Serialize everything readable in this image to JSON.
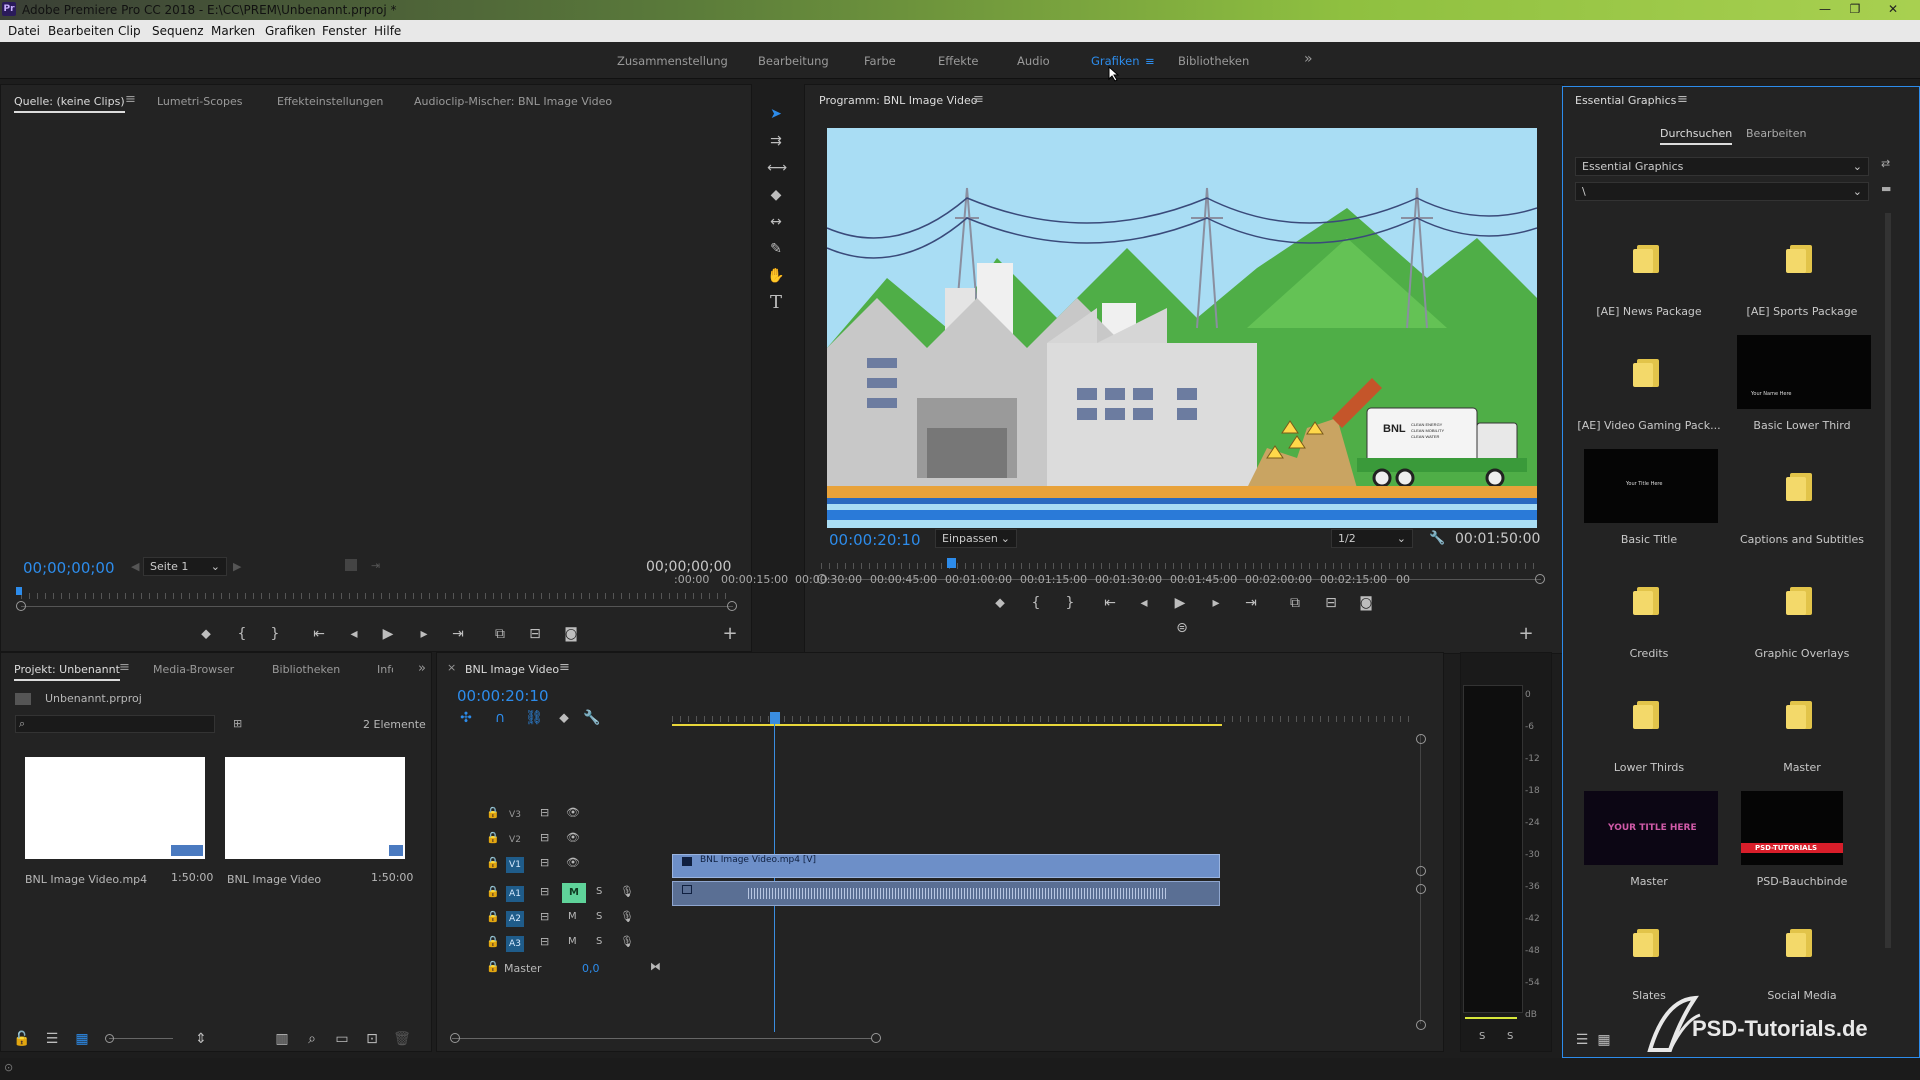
{
  "window": {
    "app_icon": "Pr",
    "title": "Adobe Premiere Pro CC 2018 - E:\\CC\\PREM\\Unbenannt.prproj *",
    "minimize": "—",
    "restore": "❐",
    "close": "✕"
  },
  "menu": [
    "Datei",
    "Bearbeiten",
    "Clip",
    "Sequenz",
    "Marken",
    "Grafiken",
    "Fenster",
    "Hilfe"
  ],
  "workspaces": {
    "items": [
      "Zusammenstellung",
      "Bearbeitung",
      "Farbe",
      "Effekte",
      "Audio",
      "Grafiken",
      "Bibliotheken"
    ],
    "active": "Grafiken",
    "more": "»",
    "menu_glyph": "≡"
  },
  "source": {
    "tabs": [
      "Quelle: (keine Clips)",
      "Lumetri-Scopes",
      "Effekteinstellungen",
      "Audioclip-Mischer: BNL Image Video"
    ],
    "timecode_in": "00;00;00;00",
    "page": "Seite 1",
    "timecode_out": "00;00;00;00"
  },
  "program": {
    "title": "Programm: BNL Image Video",
    "timecode": "00:00:20:10",
    "fit": "Einpassen",
    "resolution": "1/2",
    "duration": "00:01:50:00",
    "truck_text": [
      "BNL",
      "CLEAN ENERGY",
      "CLEAN MOBILITY",
      "CLEAN WATER"
    ]
  },
  "project": {
    "tabs": [
      "Projekt: Unbenannt",
      "Media-Browser",
      "Bibliotheken",
      "Info"
    ],
    "file": "Unbenannt.prproj",
    "count": "2 Elemente",
    "items": [
      {
        "name": "BNL Image Video.mp4",
        "duration": "1:50:00"
      },
      {
        "name": "BNL Image Video",
        "duration": "1:50:00"
      }
    ]
  },
  "timeline": {
    "tab": "BNL Image Video",
    "close": "×",
    "timecode": "00:00:20:10",
    "ticks": [
      ":00:00",
      "00:00:15:00",
      "00:00:30:00",
      "00:00:45:00",
      "00:01:00:00",
      "00:01:15:00",
      "00:01:30:00",
      "00:01:45:00",
      "00:02:00:00",
      "00:02:15:00",
      "00:0"
    ],
    "video_tracks": [
      "V3",
      "V2",
      "V1"
    ],
    "audio_tracks": [
      "A1",
      "A2",
      "A3"
    ],
    "mute": "M",
    "solo": "S",
    "master_label": "Master",
    "master_value": "0,0",
    "clip_label": "BNL Image Video.mp4 [V]"
  },
  "meter": {
    "scale": [
      "0",
      "-6",
      "-12",
      "-18",
      "-24",
      "-30",
      "-36",
      "-42",
      "-48",
      "-54",
      "dB"
    ],
    "solo_left": "S",
    "solo_right": "S"
  },
  "essential_graphics": {
    "title": "Essential Graphics",
    "tabs": [
      "Durchsuchen",
      "Bearbeiten"
    ],
    "active_tab": "Durchsuchen",
    "dropdown": "Essential Graphics",
    "path": "\\",
    "items": [
      {
        "name": "[AE] News Package",
        "kind": "folder"
      },
      {
        "name": "[AE] Sports Package",
        "kind": "folder"
      },
      {
        "name": "[AE] Video Gaming Pack...",
        "kind": "folder"
      },
      {
        "name": "Basic Lower Third",
        "kind": "thumb",
        "thumb_text": "Your Name Here"
      },
      {
        "name": "Basic Title",
        "kind": "thumb",
        "thumb_text": "Your Title Here"
      },
      {
        "name": "Captions and Subtitles",
        "kind": "folder"
      },
      {
        "name": "Credits",
        "kind": "folder"
      },
      {
        "name": "Graphic Overlays",
        "kind": "folder"
      },
      {
        "name": "Lower Thirds",
        "kind": "folder"
      },
      {
        "name": "Master",
        "kind": "folder"
      },
      {
        "name": "Master",
        "kind": "thumb",
        "thumb_text": "YOUR TITLE HERE"
      },
      {
        "name": "PSD-Bauchbinde",
        "kind": "thumb",
        "thumb_text": "PSD-TUTORIALS"
      },
      {
        "name": "Slates",
        "kind": "folder"
      },
      {
        "name": "Social Media",
        "kind": "folder"
      }
    ]
  },
  "watermark": "PSD-Tutorials.de",
  "colors": {
    "accent": "#2d8ceb",
    "playhead": "#3a8de0",
    "clip": "#6d8fc8",
    "audio_mute_on": "#5fd39a"
  }
}
